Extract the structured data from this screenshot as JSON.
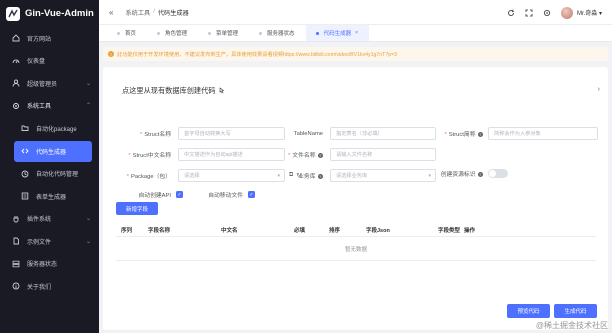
{
  "app": {
    "title": "Gin-Vue-Admin"
  },
  "sidebar": {
    "items": [
      {
        "label": "官方网站",
        "icon": "home-icon"
      },
      {
        "label": "仪表盘",
        "icon": "dashboard-icon"
      },
      {
        "label": "超级管理员",
        "icon": "user-icon",
        "has_arrow": true
      },
      {
        "label": "系统工具",
        "icon": "tools-icon",
        "has_arrow": true,
        "open": true
      },
      {
        "label": "自动化package",
        "icon": "folder-icon",
        "sub": true
      },
      {
        "label": "代码生成器",
        "icon": "code-icon",
        "sub": true,
        "active": true
      },
      {
        "label": "自动化代码管理",
        "icon": "history-icon",
        "sub": true
      },
      {
        "label": "表单生成器",
        "icon": "form-icon",
        "sub": true
      },
      {
        "label": "插件系统",
        "icon": "plugin-icon",
        "has_arrow": true
      },
      {
        "label": "示例文件",
        "icon": "file-icon",
        "has_arrow": true
      },
      {
        "label": "服务器状态",
        "icon": "server-icon"
      },
      {
        "label": "关于我们",
        "icon": "info-icon"
      }
    ]
  },
  "topbar": {
    "breadcrumb": [
      "系统工具",
      "代码生成器"
    ],
    "separator": "/",
    "user_name": "Mr.奇淼",
    "user_caret": "▾"
  },
  "tabs": [
    {
      "label": "首页"
    },
    {
      "label": "角色管理"
    },
    {
      "label": "菜单管理"
    },
    {
      "label": "服务器状态"
    },
    {
      "label": "代码生成器",
      "active": true
    }
  ],
  "warning": {
    "text": "此功能仅用于开发环境使用，不建议发布到生产，具体使用效果请看视频https://www.bilibili.com/video/BV1kv4y1g7nT?p=3"
  },
  "import_card": {
    "title": "点这里从现有数据库创建代码"
  },
  "form": {
    "struct_name": {
      "label": "Struct名称",
      "placeholder": "首字母自动转换大写"
    },
    "table_name": {
      "label": "TableName",
      "placeholder": "指定表名（非必填）"
    },
    "struct_abbr": {
      "label": "Struct简称",
      "placeholder": "简称会作为入参对象"
    },
    "struct_cn": {
      "label": "Struct中文名称",
      "placeholder": "中文描述作为自动api描述"
    },
    "file_name": {
      "label": "文件名称",
      "placeholder": "请输入文件名称"
    },
    "package": {
      "label": "Package（包）",
      "placeholder": "请选择"
    },
    "business_db": {
      "label": "业务库",
      "placeholder": "请选择业务库"
    },
    "auto_create_resource": {
      "label": "创建资源标识"
    },
    "auto_create_api": {
      "label": "自动创建API",
      "checked": true
    },
    "auto_move_file": {
      "label": "自动移动文件",
      "checked": true
    }
  },
  "buttons": {
    "new_field": "新增字段",
    "preview": "预览代码",
    "generate": "生成代码"
  },
  "table": {
    "headers": [
      "序列",
      "字段名称",
      "中文名",
      "必填",
      "排序",
      "字段Json",
      "字段类型",
      "操作"
    ],
    "empty_text": "暂无数据"
  },
  "watermark": "@稀土掘金技术社区",
  "colors": {
    "primary": "#4d70ff",
    "sidebar_bg": "#191a23",
    "warning": "#e6a23c"
  }
}
